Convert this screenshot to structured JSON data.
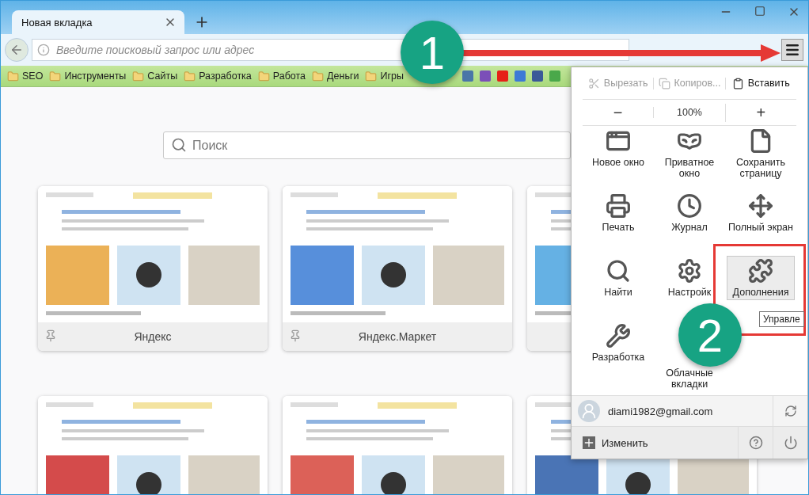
{
  "tabs": [
    {
      "label": "Новая вкладка",
      "selected": true
    }
  ],
  "address_bar": {
    "placeholder": "Введите поисковый запрос или адрес"
  },
  "bookmarks": [
    {
      "label": "SEO"
    },
    {
      "label": "Инструменты"
    },
    {
      "label": "Сайты"
    },
    {
      "label": "Разработка"
    },
    {
      "label": "Работа"
    },
    {
      "label": "Деньги"
    },
    {
      "label": "Игры"
    }
  ],
  "search": {
    "placeholder": "Поиск"
  },
  "tiles": [
    {
      "kind": "picture",
      "title": "Яндекс",
      "pinned": true
    },
    {
      "kind": "picture",
      "title": "Яндекс.Маркет",
      "pinned": true
    },
    {
      "kind": "picture"
    },
    {
      "kind": "picture"
    },
    {
      "kind": "picture"
    },
    {
      "kind": "picture"
    }
  ],
  "menu": {
    "edit": [
      {
        "label": "Вырезать",
        "kind": "cut",
        "disabled": true
      },
      {
        "label": "Копиров...",
        "kind": "copy",
        "disabled": true
      },
      {
        "label": "Вставить",
        "kind": "paste",
        "disabled": false
      }
    ],
    "zoom": {
      "out": "−",
      "level": "100%",
      "in": "+"
    },
    "items": [
      {
        "label": "Новое окно",
        "kind": "window",
        "selected": false
      },
      {
        "label": "Приватное окно",
        "kind": "mask",
        "selected": false
      },
      {
        "label": "Сохранить страницу",
        "kind": "page",
        "selected": false
      },
      {
        "label": "Печать",
        "kind": "print",
        "selected": false
      },
      {
        "label": "Журнал",
        "kind": "history",
        "selected": false
      },
      {
        "label": "Полный экран",
        "kind": "fullscreen",
        "selected": false
      },
      {
        "label": "Найти",
        "kind": "find",
        "selected": false
      },
      {
        "label": "Настройк",
        "kind": "settings",
        "selected": false
      },
      {
        "label": "Дополнения",
        "kind": "addons",
        "selected": true
      },
      {
        "label": "Разработка",
        "kind": "developer",
        "selected": false
      },
      {
        "label": "Облачные вкладки",
        "kind": "sync",
        "selected": false
      }
    ],
    "account": {
      "email": "diami1982@gmail.com"
    },
    "customize": "Изменить"
  },
  "tooltip": "Управле",
  "annotations": [
    {
      "label": "1"
    },
    {
      "label": "2"
    }
  ]
}
